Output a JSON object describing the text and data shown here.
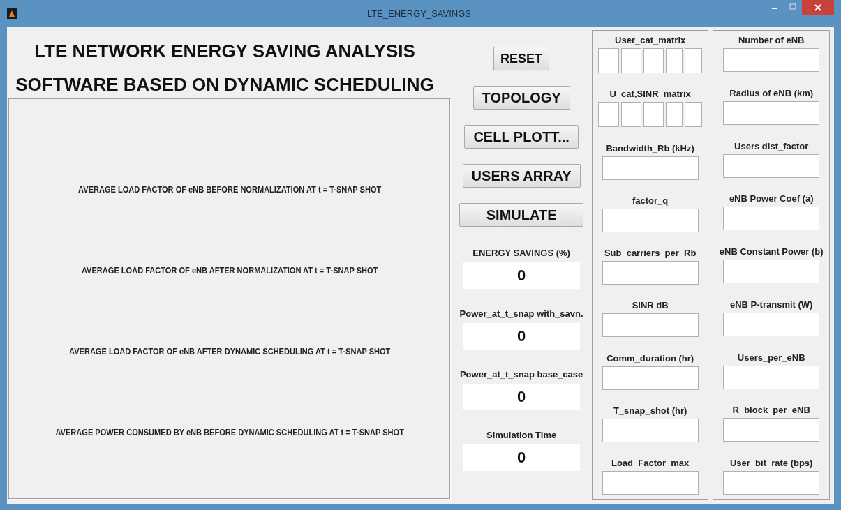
{
  "window": {
    "title": "LTE_ENERGY_SAVINGS"
  },
  "heading": [
    "LTE NETWORK ENERGY SAVING ANALYSIS",
    "SOFTWARE BASED ON DYNAMIC SCHEDULING"
  ],
  "results_labels": [
    "AVERAGE LOAD FACTOR OF eNB BEFORE NORMALIZATION AT t = T-SNAP SHOT",
    "AVERAGE LOAD FACTOR OF eNB AFTER NORMALIZATION AT t = T-SNAP SHOT",
    "AVERAGE LOAD FACTOR OF eNB AFTER DYNAMIC SCHEDULING AT t = T-SNAP SHOT",
    "AVERAGE POWER CONSUMED BY eNB BEFORE DYNAMIC SCHEDULING AT t = T-SNAP SHOT"
  ],
  "buttons": [
    {
      "label": "RESET",
      "kind": "small"
    },
    {
      "label": "TOPOLOGY",
      "kind": "medium"
    },
    {
      "label": "CELL PLOTT...",
      "kind": "medium"
    },
    {
      "label": "USERS ARRAY",
      "kind": "medium"
    },
    {
      "label": "SIMULATE",
      "kind": "wide"
    }
  ],
  "outputs": [
    {
      "label": "ENERGY SAVINGS (%)",
      "value": "0"
    },
    {
      "label": "Power_at_t_snap with_savn.",
      "value": "0"
    },
    {
      "label": "Power_at_t_snap base_case",
      "value": "0"
    },
    {
      "label": "Simulation Time",
      "value": "0"
    }
  ],
  "input_columns": [
    [
      {
        "label": "User_cat_matrix",
        "kind": "matrix"
      },
      {
        "label": "U_cat,SINR_matrix",
        "kind": "matrix"
      },
      {
        "label": "Bandwidth_Rb (kHz)",
        "kind": "field"
      },
      {
        "label": "factor_q",
        "kind": "field"
      },
      {
        "label": "Sub_carriers_per_Rb",
        "kind": "field"
      },
      {
        "label": "SINR dB",
        "kind": "field"
      },
      {
        "label": "Comm_duration (hr)",
        "kind": "field"
      },
      {
        "label": "T_snap_shot (hr)",
        "kind": "field"
      },
      {
        "label": "Load_Factor_max",
        "kind": "field"
      }
    ],
    [
      {
        "label": "Number of eNB",
        "kind": "field"
      },
      {
        "label": "Radius of eNB (km)",
        "kind": "field"
      },
      {
        "label": "Users dist_factor",
        "kind": "field"
      },
      {
        "label": "eNB Power Coef (a)",
        "kind": "field"
      },
      {
        "label": "eNB Constant Power (b)",
        "kind": "field"
      },
      {
        "label": "eNB P-transmit (W)",
        "kind": "field"
      },
      {
        "label": "Users_per_eNB",
        "kind": "field"
      },
      {
        "label": "R_block_per_eNB",
        "kind": "field"
      },
      {
        "label": "User_bit_rate (bps)",
        "kind": "field"
      }
    ]
  ]
}
